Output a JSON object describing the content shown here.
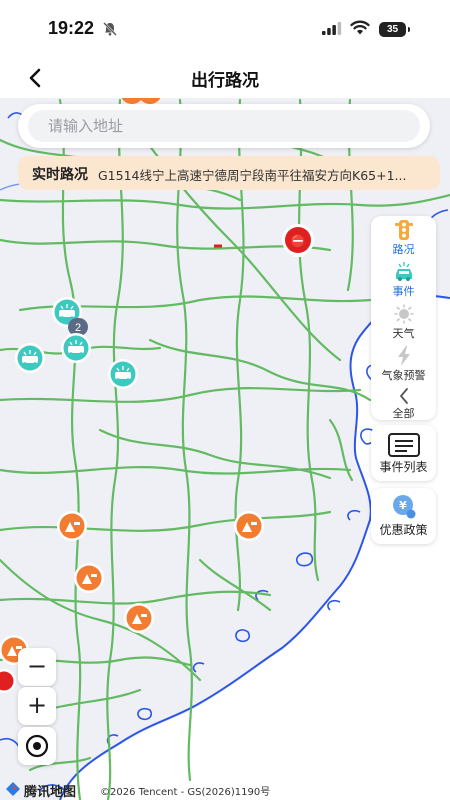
{
  "status_bar": {
    "time": "19:22",
    "battery": "35"
  },
  "nav": {
    "title": "出行路况"
  },
  "search": {
    "placeholder": "请输入地址"
  },
  "banner": {
    "label": "实时路况",
    "text": "G1514线宁上高速宁德周宁段南平往福安方向K65+1..."
  },
  "layer_panel": {
    "items": [
      {
        "label": "路况",
        "icon": "traffic-light-icon"
      },
      {
        "label": "事件",
        "icon": "car-accident-icon"
      },
      {
        "label": "天气",
        "icon": "sun-icon"
      },
      {
        "label": "气象预警",
        "icon": "lightning-icon"
      },
      {
        "label": "全部",
        "icon": "chevron-left-icon"
      }
    ]
  },
  "tools": {
    "event_list": {
      "label": "事件列表",
      "icon": "list-icon"
    },
    "discount": {
      "label": "优惠政策",
      "icon": "discount-icon"
    }
  },
  "map_controls": {
    "zoom_out": "−",
    "zoom_in": "+",
    "locate_icon": "locate-icon"
  },
  "attribution": {
    "logo": "腾讯地图",
    "copyright": "©2026 Tencent - GS(2026)1190号"
  },
  "markers": {
    "control_label": "2",
    "types": [
      "road-closure-icon",
      "accident-icon",
      "construction-icon"
    ]
  },
  "colors": {
    "accent": "#1f6fe0",
    "road": "#5cb85c",
    "coast": "#2d56e8",
    "banner": "#fbe6cf",
    "construction": "#f27c31",
    "accident": "#3cc9c0",
    "closure": "#e02020"
  }
}
